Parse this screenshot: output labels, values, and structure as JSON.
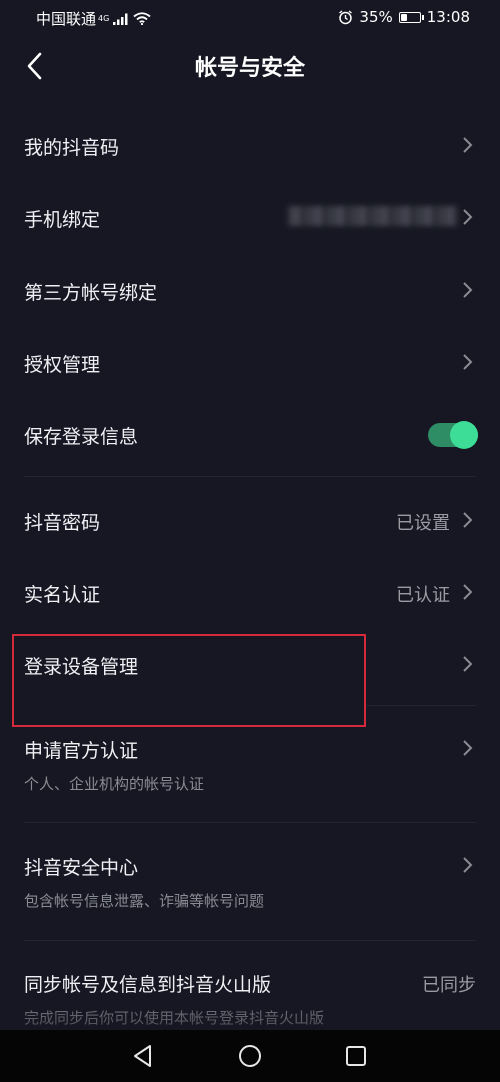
{
  "status_bar": {
    "carrier": "中国联通",
    "network": "4G",
    "battery": "35%",
    "battery_level": 0.35,
    "time": "13:08"
  },
  "header": {
    "title": "帐号与安全"
  },
  "settings": {
    "douyin_code": "我的抖音码",
    "phone_binding": "手机绑定",
    "third_party": "第三方帐号绑定",
    "authorization": "授权管理",
    "save_login": "保存登录信息",
    "save_login_on": true,
    "password": "抖音密码",
    "password_value": "已设置",
    "real_name": "实名认证",
    "real_name_value": "已认证",
    "login_devices": "登录设备管理",
    "official_verify": "申请官方认证",
    "official_verify_sub": "个人、企业机构的帐号认证",
    "security_center": "抖音安全中心",
    "security_center_sub": "包含帐号信息泄露、诈骗等帐号问题",
    "sync": "同步帐号及信息到抖音火山版",
    "sync_value": "已同步",
    "sync_sub": "完成同步后你可以使用本帐号登录抖音火山版"
  },
  "colors": {
    "background": "#161722",
    "toggle_on": "#3ddc97",
    "highlight": "#d42a3c"
  }
}
